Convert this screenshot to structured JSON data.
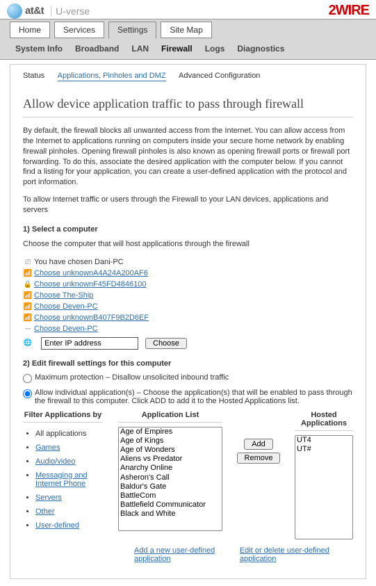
{
  "logo": {
    "att": "at&t",
    "uverse": "U-verse",
    "brand": "2WIRE"
  },
  "mainTabs": {
    "t0": "Home",
    "t1": "Services",
    "t2": "Settings",
    "t3": "Site Map"
  },
  "subTabs": {
    "s0": "System Info",
    "s1": "Broadband",
    "s2": "LAN",
    "s3": "Firewall",
    "s4": "Logs",
    "s5": "Diagnostics"
  },
  "subnav": {
    "n0": "Status",
    "n1": "Applications, Pinholes and DMZ",
    "n2": "Advanced Configuration"
  },
  "page": {
    "title": "Allow device application traffic to pass through firewall",
    "intro": "By default, the firewall blocks all unwanted access from the Internet. You can allow access from the Internet to applications running on computers inside your secure home network by enabling firewall pinholes. Opening firewall pinholes is also known as opening firewall ports or firewall port forwarding. To do this, associate the desired application with the computer below. If you cannot find a listing for your application, you can create a user-defined application with the protocol and port information.",
    "intro2": "To allow Internet traffic or users through the Firewall to your LAN devices, applications and servers",
    "step1": "1) Select a computer",
    "step1desc": "Choose the computer that will host applications through the firewall",
    "chosen": "You have chosen Dani-PC",
    "devices": {
      "d0": "Choose unknownA4A24A200AF6",
      "d1": "Choose unknownF45FD4846100",
      "d2": "Choose The-Ship",
      "d3": "Choose Deven-PC",
      "d4": "Choose unknownB407F9B2D6EF",
      "d5": "Choose Deven-PC"
    },
    "ipPlaceholder": "Enter IP address",
    "chooseBtn": "Choose",
    "step2": "2) Edit firewall settings for this computer",
    "radio1": "Maximum protection – Disallow unsolicited inbound traffic",
    "radio2": "Allow individual application(s) – Choose the application(s) that will be enabled to pass through the firewall to this computer. Click ADD to add it to the Hosted Applications list.",
    "headers": {
      "h1": "Filter Applications by",
      "h2": "Application List",
      "h3": "Hosted Applications"
    },
    "filters": {
      "f0": "All applications",
      "f1": "Games",
      "f2": "Audio/video",
      "f3": "Messaging and Internet Phone",
      "f4": "Servers",
      "f5": "Other",
      "f6": "User-defined"
    },
    "apps": {
      "a0": "Age of Empires",
      "a1": "Age of Kings",
      "a2": "Age of Wonders",
      "a3": "Aliens vs Predator",
      "a4": "Anarchy Online",
      "a5": "Asheron's Call",
      "a6": "Baldur's Gate",
      "a7": "BattleCom",
      "a8": "Battlefield Communicator",
      "a9": "Black and White"
    },
    "hosted": {
      "h0": "UT4",
      "h1": "UT#"
    },
    "addBtn": "Add",
    "removeBtn": "Remove",
    "newAppLink": "Add a new user-defined application",
    "editLink": "Edit or delete user-defined application"
  }
}
